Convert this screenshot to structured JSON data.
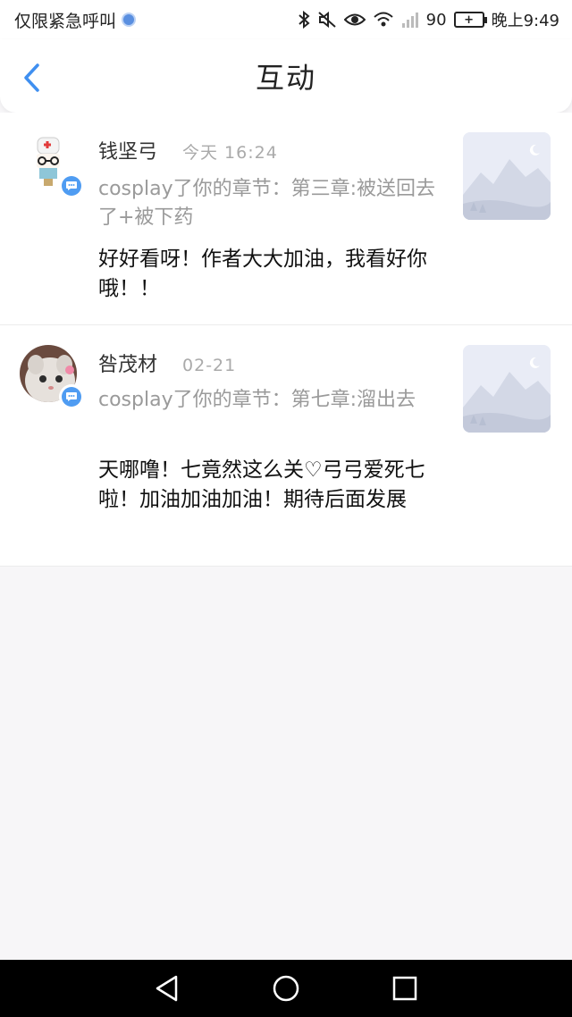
{
  "status_bar": {
    "left_text": "仅限紧急呼叫",
    "battery_text": "90",
    "battery_label": "+",
    "time": "晚上9:49"
  },
  "header": {
    "title": "互动"
  },
  "items": [
    {
      "user_name": "钱坚弓",
      "time": "今天 16:24",
      "chapter": "cosplay了你的章节：第三章:被送回去了+被下药",
      "comment": "好好看呀！作者大大加油，我看好你哦！！"
    },
    {
      "user_name": "咎茂材",
      "time": "02-21",
      "chapter": "cosplay了你的章节：第七章:溜出去",
      "comment": "天哪噜！七竟然这么关♡弓弓爱死七啦！加油加油加油！期待后面发展"
    }
  ],
  "colors": {
    "accent": "#4f9cf2",
    "secondary_text": "#9a9a9a",
    "background": "#f7f6f8"
  },
  "icons": {
    "back": "chevron-left-icon",
    "badge": "chat-bubble-icon",
    "thumbnail": "mountain-placeholder-icon",
    "nav_back": "triangle-back-icon",
    "nav_home": "circle-home-icon",
    "nav_recent": "square-recent-icon"
  }
}
